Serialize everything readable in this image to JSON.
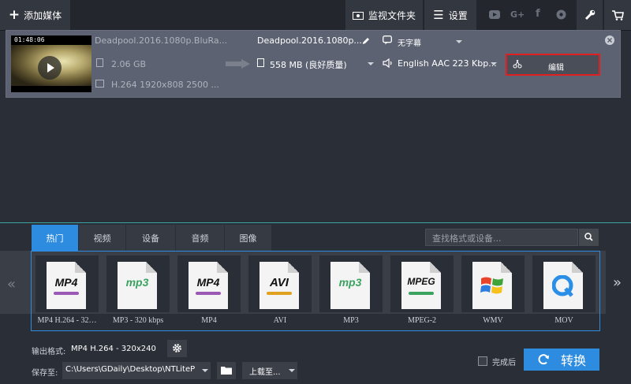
{
  "topbar": {
    "add_media": "添加媒体",
    "watch_folder": "监视文件夹",
    "settings": "设置",
    "social": [
      "youtube",
      "google-plus",
      "facebook",
      "vk"
    ],
    "google_plus_text": "G+",
    "facebook_text": "f"
  },
  "media": {
    "duration": "01:48:06",
    "source_name": "Deadpool.2016.1080p.BluRa...",
    "source_size": "2.06 GB",
    "source_video": "H.264 1920x808 2500 ...",
    "output_name": "Deadpool.2016.1080p....",
    "output_size": "558 MB (良好质量)",
    "subtitle": "无字幕",
    "audio": "English AAC 223 Kbp...",
    "edit": "编辑"
  },
  "tabs": [
    {
      "label": "热门",
      "active": true
    },
    {
      "label": "视频",
      "active": false
    },
    {
      "label": "设备",
      "active": false
    },
    {
      "label": "音频",
      "active": false
    },
    {
      "label": "图像",
      "active": false
    }
  ],
  "search": {
    "placeholder": "查找格式或设备..."
  },
  "formats": [
    {
      "icon": "MP4",
      "label": "MP4 H.264 - 32…",
      "bar": "#9b59b6"
    },
    {
      "icon": "mp3",
      "label": "MP3 - 320 kbps",
      "bar": "#3aa35f"
    },
    {
      "icon": "MP4",
      "label": "MP4",
      "bar": "#9b59b6"
    },
    {
      "icon": "AVI",
      "label": "AVI",
      "bar": "#e0a020"
    },
    {
      "icon": "mp3",
      "label": "MP3",
      "bar": "#3aa35f"
    },
    {
      "icon": "MPEG",
      "label": "MPEG-2",
      "bar": "#3aa35f"
    },
    {
      "icon": "windows",
      "label": "WMV",
      "bar": ""
    },
    {
      "icon": "quicktime",
      "label": "MOV",
      "bar": ""
    }
  ],
  "bottom": {
    "output_label": "输出格式:",
    "output_value": "MP4 H.264 - 320x240",
    "save_label": "保存至:",
    "save_path": "C:\\Users\\GDaily\\Desktop\\NTLiteP",
    "upload": "上载至...",
    "after_done": "完成后",
    "convert": "转换"
  },
  "colors": {
    "accent": "#2d8ce0",
    "highlight": "#e02020"
  }
}
